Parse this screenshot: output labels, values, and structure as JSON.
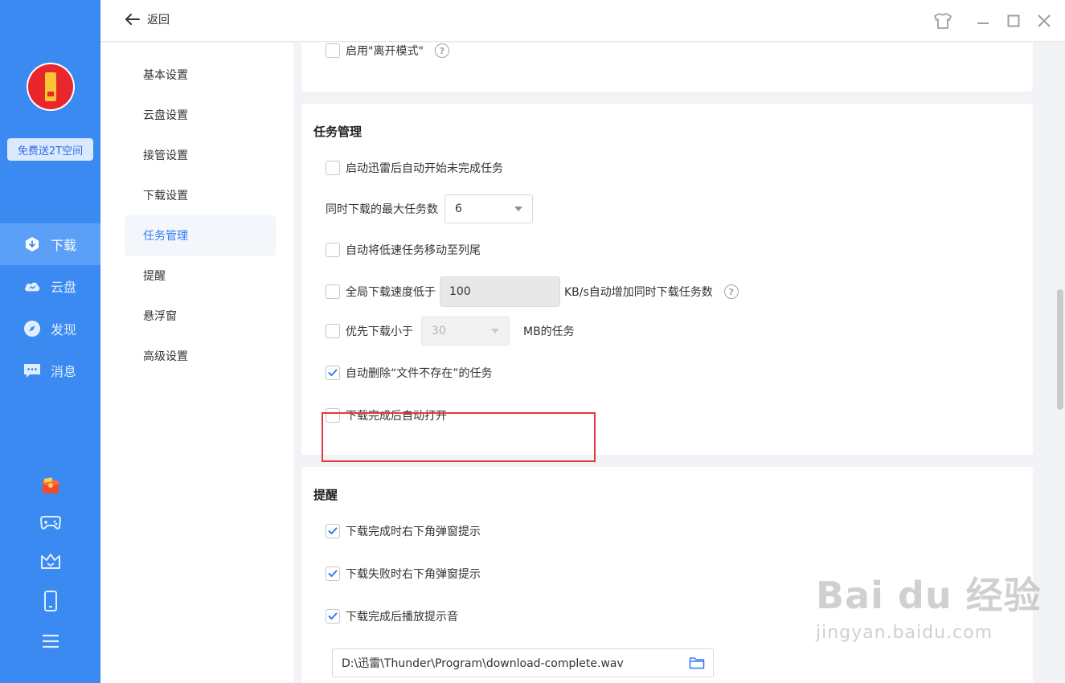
{
  "sidebar": {
    "promo": "免费送2T空间",
    "nav": [
      {
        "label": "下载",
        "icon": "download-icon"
      },
      {
        "label": "云盘",
        "icon": "cloud-icon"
      },
      {
        "label": "发现",
        "icon": "compass-icon"
      },
      {
        "label": "消息",
        "icon": "message-icon"
      }
    ],
    "bottom_icons": [
      "red-envelope-icon",
      "gamepad-icon",
      "crown-icon",
      "phone-icon",
      "menu-icon"
    ]
  },
  "titlebar": {
    "back_label": "返回",
    "controls": [
      "skin-icon",
      "minimize-icon",
      "maximize-icon",
      "close-icon"
    ]
  },
  "settings_nav": [
    "基本设置",
    "云盘设置",
    "接管设置",
    "下载设置",
    "任务管理",
    "提醒",
    "悬浮窗",
    "高级设置"
  ],
  "settings_nav_active": "任务管理",
  "top_card": {
    "leave_mode_label": "启用\"离开模式\"",
    "help_mark": "?"
  },
  "task_mgmt": {
    "title": "任务管理",
    "auto_start_label": "启动迅雷后自动开始未完成任务",
    "max_tasks_label": "同时下载的最大任务数",
    "max_tasks_value": "6",
    "move_slow_label": "自动将低速任务移动至列尾",
    "speed_prefix": "全局下载速度低于",
    "speed_value": "100",
    "speed_suffix": "KB/s自动增加同时下载任务数",
    "prefer_small_prefix": "优先下载小于",
    "prefer_small_value": "30",
    "prefer_small_suffix": "MB的任务",
    "auto_delete_label": "自动删除“文件不存在”的任务",
    "auto_open_label": "下载完成后自动打开"
  },
  "reminder": {
    "title": "提醒",
    "complete_popup_label": "下载完成时右下角弹窗提示",
    "fail_popup_label": "下载失败时右下角弹窗提示",
    "complete_sound_label": "下载完成后播放提示音",
    "sound_path": "D:\\迅雷\\Thunder\\Program\\download-complete.wav"
  },
  "watermark": {
    "main": "Bai du 经验",
    "sub": "jingyan.baidu.com"
  },
  "colors": {
    "sidebar": "#3a8af2",
    "accent": "#2e7cf6",
    "highlight_border": "#e0393e"
  }
}
